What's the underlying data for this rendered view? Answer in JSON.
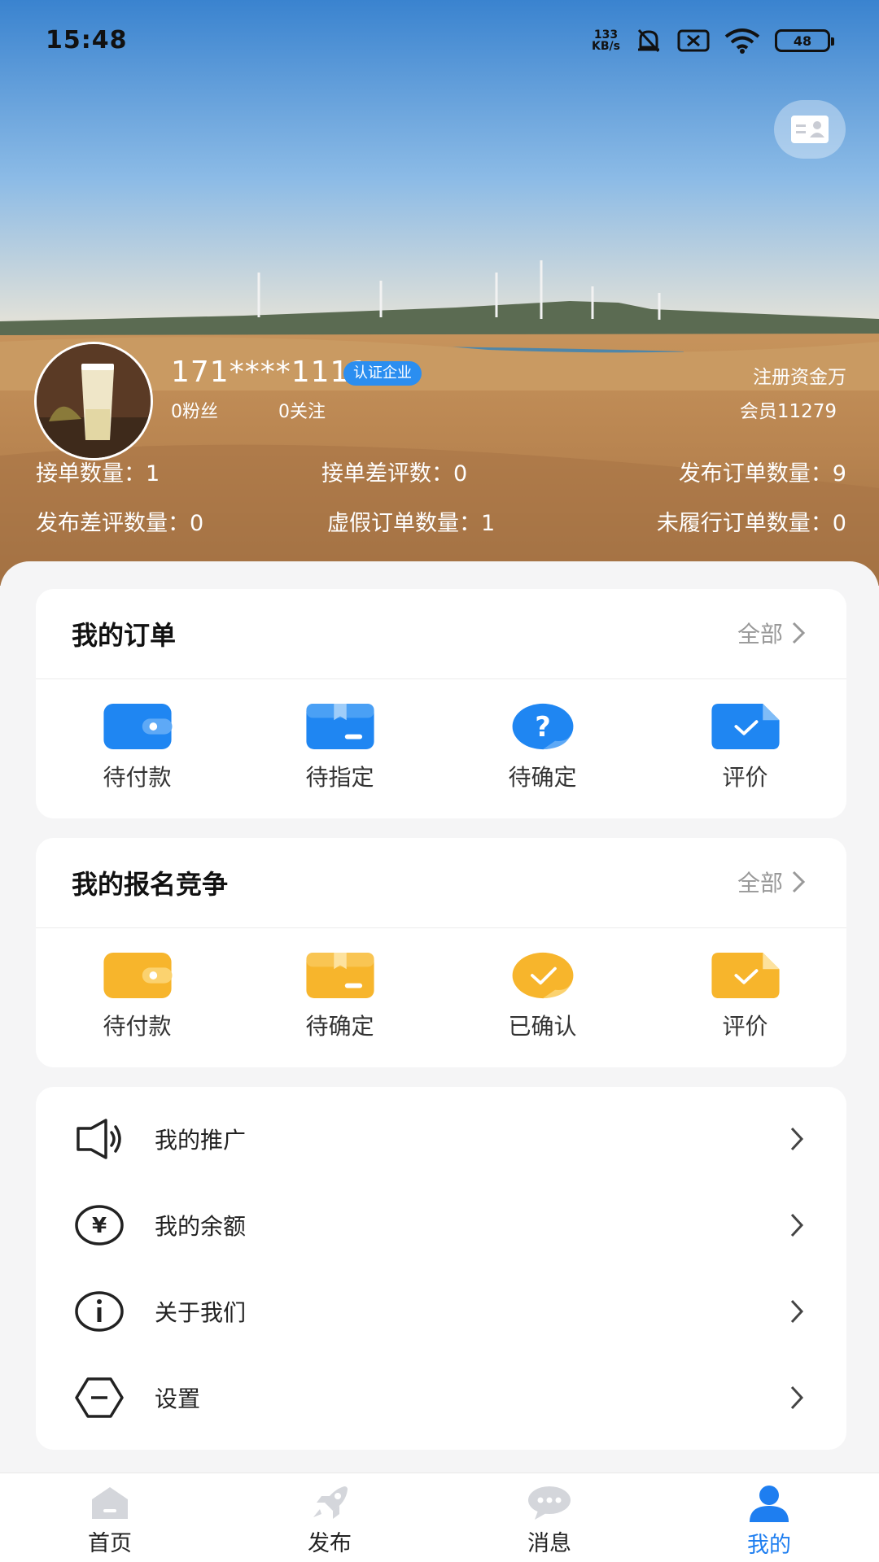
{
  "status_bar": {
    "time": "15:48",
    "net_speed_value": "133",
    "net_speed_unit": "KB/s",
    "battery": "48"
  },
  "profile": {
    "username": "171****1111",
    "cert_badge": "认证企业",
    "fans": "0粉丝",
    "follows": "0关注",
    "capital": "注册资金万",
    "member": "会员11279"
  },
  "stats": {
    "orders_taken": "接单数量：1",
    "orders_taken_bad": "接单差评数：0",
    "orders_published": "发布订单数量：9",
    "published_bad": "发布差评数量：0",
    "fake_orders": "虚假订单数量：1",
    "unfulfilled": "未履行订单数量：0"
  },
  "my_orders": {
    "title": "我的订单",
    "all": "全部",
    "items": [
      {
        "label": "待付款",
        "icon": "wallet-icon"
      },
      {
        "label": "待指定",
        "icon": "box-icon"
      },
      {
        "label": "待确定",
        "icon": "question-icon"
      },
      {
        "label": "评价",
        "icon": "review-icon"
      }
    ]
  },
  "my_bids": {
    "title": "我的报名竞争",
    "all": "全部",
    "items": [
      {
        "label": "待付款",
        "icon": "wallet-icon"
      },
      {
        "label": "待确定",
        "icon": "box-icon"
      },
      {
        "label": "已确认",
        "icon": "check-circle-icon"
      },
      {
        "label": "评价",
        "icon": "review-icon"
      }
    ]
  },
  "menu": [
    {
      "label": "我的推广",
      "icon": "speaker-icon"
    },
    {
      "label": "我的余额",
      "icon": "yen-icon"
    },
    {
      "label": "关于我们",
      "icon": "info-icon"
    },
    {
      "label": "设置",
      "icon": "settings-hex-icon"
    }
  ],
  "tabbar": [
    {
      "label": "首页",
      "icon": "home-icon"
    },
    {
      "label": "发布",
      "icon": "rocket-icon"
    },
    {
      "label": "消息",
      "icon": "message-icon"
    },
    {
      "label": "我的",
      "icon": "user-icon",
      "active": true
    }
  ],
  "colors": {
    "accent_blue": "#1e7ef0",
    "order_blue": "#1f86f2",
    "bid_yellow": "#f7b52c",
    "badge_blue": "#2b8ef0"
  }
}
